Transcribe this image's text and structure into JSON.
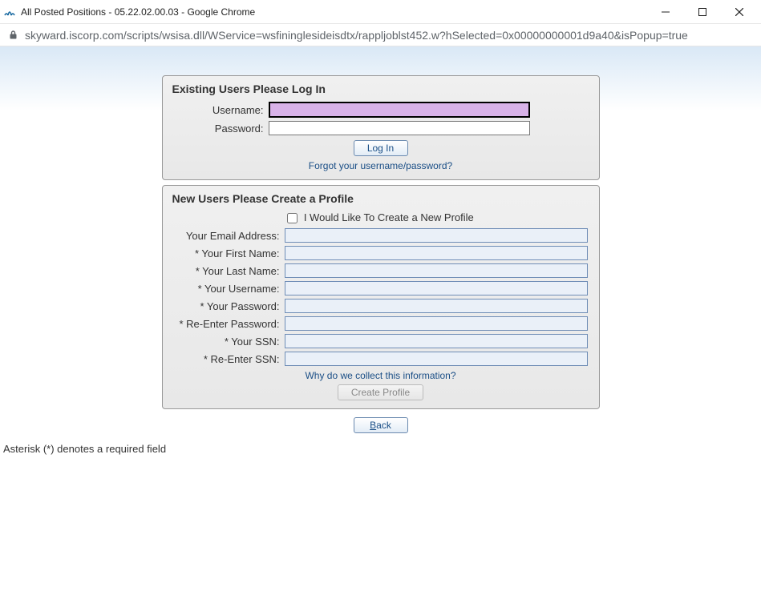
{
  "window": {
    "title": "All Posted Positions - 05.22.02.00.03 - Google Chrome"
  },
  "address": {
    "url": "skyward.iscorp.com/scripts/wsisa.dll/WService=wsfininglesideisdtx/rappljoblst452.w?hSelected=0x00000000001d9a40&isPopup=true"
  },
  "login": {
    "heading": "Existing Users Please Log In",
    "username_label": "Username:",
    "username_value": "",
    "password_label": "Password:",
    "password_value": "",
    "login_button": "Log In",
    "forgot_link": "Forgot your username/password?"
  },
  "profile": {
    "heading": "New Users Please Create a Profile",
    "checkbox_label": "I Would Like To Create a New Profile",
    "checkbox_checked": false,
    "labels": {
      "email": "Your Email Address:",
      "first": "* Your First Name:",
      "last": "* Your Last Name:",
      "user": "* Your Username:",
      "pass": "* Your Password:",
      "pass2": "* Re-Enter Password:",
      "ssn": "* Your SSN:",
      "ssn2": "* Re-Enter SSN:"
    },
    "info_link": "Why do we collect this information?",
    "create_button": "Create Profile"
  },
  "back_button": "Back",
  "footnote": "Asterisk (*) denotes a required field"
}
